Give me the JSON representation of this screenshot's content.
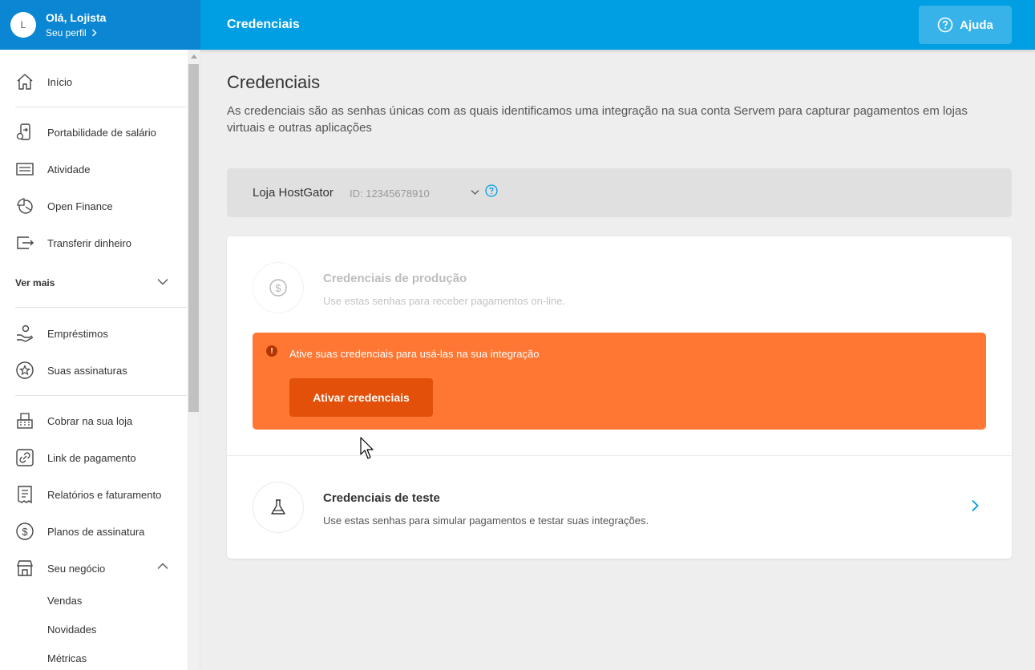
{
  "header": {
    "avatar_initial": "L",
    "greeting": "Olá, Lojista",
    "profile_link": "Seu perfil",
    "title": "Credenciais",
    "help_label": "Ajuda"
  },
  "sidebar": {
    "items": [
      {
        "label": "Início",
        "icon": "home-icon"
      },
      {
        "label": "Portabilidade de salário",
        "icon": "phone-transfer-icon"
      },
      {
        "label": "Atividade",
        "icon": "list-icon"
      },
      {
        "label": "Open Finance",
        "icon": "open-finance-icon"
      },
      {
        "label": "Transferir dinheiro",
        "icon": "transfer-icon"
      },
      {
        "label": "Empréstimos",
        "icon": "loan-icon"
      },
      {
        "label": "Suas assinaturas",
        "icon": "star-badge-icon"
      },
      {
        "label": "Cobrar na sua loja",
        "icon": "cash-register-icon"
      },
      {
        "label": "Link de pagamento",
        "icon": "link-icon"
      },
      {
        "label": "Relatórios e faturamento",
        "icon": "receipt-icon"
      },
      {
        "label": "Planos de assinatura",
        "icon": "dollar-cycle-icon"
      },
      {
        "label": "Seu negócio",
        "icon": "store-icon"
      }
    ],
    "ver_mais": "Ver mais",
    "sub_items": [
      "Vendas",
      "Novidades",
      "Métricas"
    ]
  },
  "main": {
    "title": "Credenciais",
    "description": "As credenciais são as senhas únicas com as quais identificamos uma integração na sua conta Servem para capturar pagamentos em lojas virtuais e outras aplicações",
    "store": {
      "name": "Loja HostGator",
      "id": "ID: 12345678910"
    },
    "production": {
      "title": "Credenciais de produção",
      "description": "Use estas senhas para receber pagamentos on-line."
    },
    "alert": {
      "message": "Ative suas credenciais para usá-las na sua integração",
      "button": "Ativar credenciais"
    },
    "test": {
      "title": "Credenciais de teste",
      "description": "Use estas senhas para simular pagamentos e testar suas integrações."
    }
  },
  "colors": {
    "topbar": "#009ee3",
    "profile_bg": "#0a86d3",
    "alert": "#ff7733",
    "alert_button": "#e2500a",
    "link_blue": "#009ee3"
  }
}
